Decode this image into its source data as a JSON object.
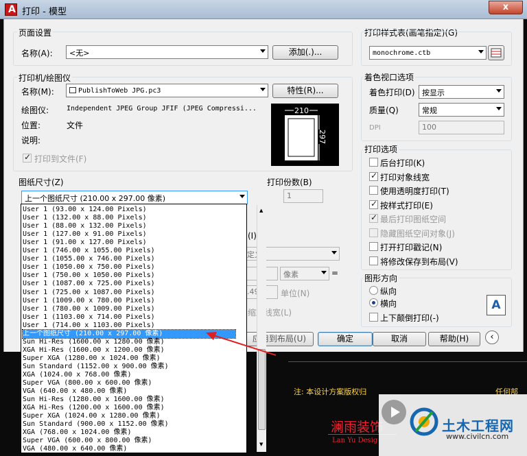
{
  "window": {
    "title": "打印 - 模型",
    "close": "x"
  },
  "page_setup": {
    "group": "页面设置",
    "name_label": "名称(A):",
    "name_value": "<无>",
    "add_button": "添加(.)..."
  },
  "printer": {
    "group": "打印机/绘图仪",
    "name_label": "名称(M):",
    "name_value": "PublishToWeb JPG.pc3",
    "props_button": "特性(R)...",
    "plotter_label": "绘图仪:",
    "plotter_value": "Independent JPEG Group JFIF (JPEG Compressi...",
    "location_label": "位置:",
    "location_value": "文件",
    "desc_label": "说明:",
    "print_to_file": "打印到文件(F)",
    "preview_width": "210",
    "preview_height": "297"
  },
  "paper_size": {
    "group": "图纸尺寸(Z)",
    "value": "上一个图纸尺寸  (210.00 x 297.00 像素)"
  },
  "copies": {
    "group": "打印份数(B)",
    "value": "1"
  },
  "hidden_area": {
    "label_i": "(I)",
    "custom_text": "定义",
    "units_text": "像素",
    "eq": "=",
    "value": ".49",
    "units_label": "单位(N)",
    "scale_lineweight": "缩放线宽(L)",
    "apply_layout": "应用到布局(U)"
  },
  "plot_style": {
    "group": "打印样式表(画笔指定)(G)",
    "value": "monochrome.ctb"
  },
  "shaded": {
    "group": "着色视口选项",
    "shade_label": "着色打印(D)",
    "shade_value": "按显示",
    "quality_label": "质量(Q)",
    "quality_value": "常规",
    "dpi_label": "DPI",
    "dpi_value": "100"
  },
  "options": {
    "group": "打印选项",
    "items": [
      {
        "label": "后台打印(K)",
        "checked": false,
        "disabled": false
      },
      {
        "label": "打印对象线宽",
        "checked": true,
        "disabled": false
      },
      {
        "label": "使用透明度打印(T)",
        "checked": false,
        "disabled": false
      },
      {
        "label": "按样式打印(E)",
        "checked": true,
        "disabled": false
      },
      {
        "label": "最后打印图纸空间",
        "checked": true,
        "disabled": true
      },
      {
        "label": "隐藏图纸空间对象(J)",
        "checked": false,
        "disabled": true
      },
      {
        "label": "打开打印戳记(N)",
        "checked": false,
        "disabled": false
      },
      {
        "label": "将修改保存到布局(V)",
        "checked": false,
        "disabled": false
      }
    ]
  },
  "orientation": {
    "group": "图形方向",
    "portrait": "纵向",
    "landscape": "横向",
    "upside_down": "上下颠倒打印(-)",
    "selected": "landscape"
  },
  "footer": {
    "ok": "确定",
    "cancel": "取消",
    "help": "帮助(H)"
  },
  "paper_list": [
    "User 1 (93.00 x 124.00 Pixels)",
    "User 1 (132.00 x 88.00 Pixels)",
    "User 1 (88.00 x 132.00 Pixels)",
    "User 1 (127.00 x 91.00 Pixels)",
    "User 1 (91.00 x 127.00 Pixels)",
    "User 1 (746.00 x 1055.00 Pixels)",
    "User 1 (1055.00 x 746.00 Pixels)",
    "User 1 (1050.00 x 750.00 Pixels)",
    "User 1 (750.00 x 1050.00 Pixels)",
    "User 1 (1087.00 x 725.00 Pixels)",
    "User 1 (725.00 x 1087.00 Pixels)",
    "User 1 (1009.00 x 780.00 Pixels)",
    "User 1 (780.00 x 1009.00 Pixels)",
    "User 1 (1103.00 x 714.00 Pixels)",
    "User 1 (714.00 x 1103.00 Pixels)",
    "上一个图纸尺寸  (210.00 x 297.00 像素)",
    "Sun Hi-Res (1600.00 x 1280.00 像素)",
    "XGA Hi-Res (1600.00 x 1200.00 像素)",
    "Super XGA (1280.00 x 1024.00 像素)",
    "Sun Standard (1152.00 x 900.00 像素)",
    "XGA (1024.00 x 768.00 像素)",
    "Super VGA (800.00 x 600.00 像素)",
    "VGA (640.00 x 480.00 像素)",
    "Sun Hi-Res (1280.00 x 1600.00 像素)",
    "XGA Hi-Res (1200.00 x 1600.00 像素)",
    "Super XGA (1024.00 x 1280.00 像素)",
    "Sun Standard (900.00 x 1152.00 像素)",
    "XGA (768.00 x 1024.00 像素)",
    "Super VGA (600.00 x 800.00 像素)",
    "VGA (480.00 x 640.00 像素)"
  ],
  "paper_list_selected": 15,
  "background": {
    "note": "注: 本设计方案版权归",
    "note_right": "任何部",
    "logo_text": "澜雨装饰",
    "logo_sub": "Lan Yu Desig",
    "watermark_name": "土木工程网",
    "watermark_url": "www.civilcn.com"
  },
  "colors": {
    "accent": "#3399ff",
    "annotation_arrow": "#e02020",
    "watermark": "#1666b0"
  }
}
